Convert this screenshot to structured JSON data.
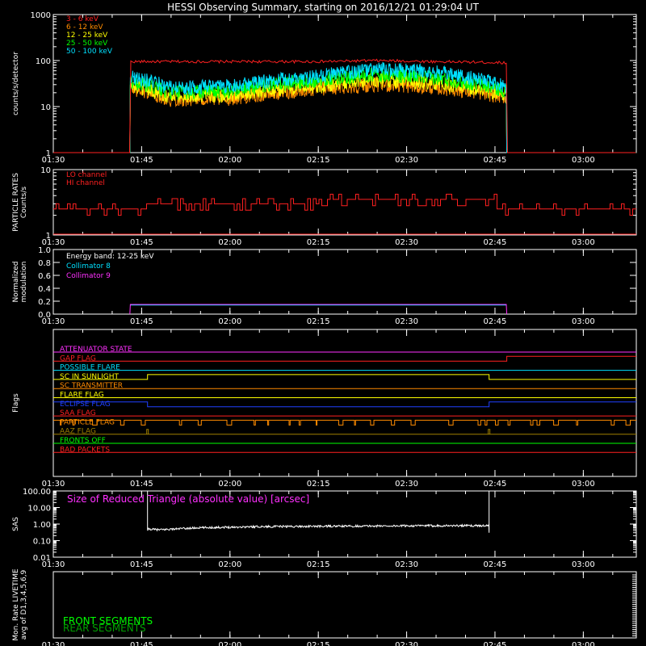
{
  "title": "HESSI Observing Summary, starting on 2016/12/21 01:29:04 UT",
  "time_ticks": [
    "01:30",
    "01:45",
    "02:00",
    "02:15",
    "02:30",
    "02:45",
    "03:00"
  ],
  "colors": {
    "c3_6": "#ff2020",
    "c6_12": "#ff8c00",
    "c12_25": "#ffff00",
    "c25_50": "#00ff00",
    "c50_100": "#00e0ff",
    "lo": "#ff2020",
    "hi": "#ff2020",
    "collimator8": "#00e0ff",
    "collimator9": "#ff30ff",
    "sas": "#ffffff",
    "front": "#00ff00",
    "rear": "#00a000"
  },
  "chart_data": [
    {
      "id": "count-rates",
      "type": "line",
      "ylabel": "counts/s/detector",
      "yscale": "log",
      "ylim": [
        1,
        1000
      ],
      "yticks": [
        "1",
        "10",
        "100",
        "1000"
      ],
      "xlim": [
        "01:30",
        "03:09"
      ],
      "series": [
        {
          "name": "3 - 6 keV",
          "x": [
            "01:30",
            "01:43",
            "01:43",
            "02:00",
            "02:15",
            "02:25",
            "02:35",
            "02:47",
            "02:47",
            "03:09"
          ],
          "values": [
            1,
            1,
            95,
            95,
            95,
            100,
            95,
            90,
            1,
            1
          ]
        },
        {
          "name": "6 - 12 keV",
          "x": [
            "01:30",
            "01:43",
            "01:43",
            "01:50",
            "02:00",
            "02:15",
            "02:25",
            "02:35",
            "02:47",
            "02:47",
            "03:09"
          ],
          "values": [
            1,
            1,
            25,
            14,
            15,
            24,
            30,
            26,
            16,
            1,
            1
          ]
        },
        {
          "name": "12 - 25 keV",
          "x": [
            "01:30",
            "01:43",
            "01:43",
            "01:50",
            "02:00",
            "02:15",
            "02:25",
            "02:35",
            "02:47",
            "02:47",
            "03:09"
          ],
          "values": [
            1,
            1,
            28,
            16,
            18,
            28,
            38,
            32,
            18,
            1,
            1
          ]
        },
        {
          "name": "25 - 50 keV",
          "x": [
            "01:30",
            "01:43",
            "01:43",
            "01:50",
            "02:00",
            "02:15",
            "02:25",
            "02:35",
            "02:47",
            "02:47",
            "03:09"
          ],
          "values": [
            1,
            1,
            35,
            20,
            22,
            38,
            50,
            42,
            22,
            1,
            1
          ]
        },
        {
          "name": "50 - 100 keV",
          "x": [
            "01:30",
            "01:43",
            "01:43",
            "01:50",
            "02:00",
            "02:15",
            "02:25",
            "02:35",
            "02:47",
            "02:47",
            "03:09"
          ],
          "values": [
            1,
            1,
            45,
            25,
            28,
            45,
            65,
            55,
            28,
            1,
            1
          ]
        }
      ]
    },
    {
      "id": "particle-rates",
      "type": "line",
      "ylabel": "PARTICLE RATES Counts/s",
      "yscale": "log",
      "ylim": [
        1,
        10
      ],
      "yticks": [
        "1",
        "10"
      ],
      "xlim": [
        "01:30",
        "03:09"
      ],
      "series": [
        {
          "name": "LO channel",
          "x": [
            "01:30",
            "01:47",
            "01:47",
            "02:15",
            "02:15",
            "02:45",
            "02:45",
            "03:09"
          ],
          "values": [
            2.5,
            2.5,
            3,
            3,
            3.5,
            3.5,
            2.5,
            2.5
          ]
        },
        {
          "name": "HI channel",
          "x": [
            "01:30",
            "03:09"
          ],
          "values": [
            1,
            1
          ]
        }
      ]
    },
    {
      "id": "modulation",
      "type": "line",
      "ylabel": "Normalized modulation",
      "ylim": [
        0,
        1
      ],
      "yticks": [
        "0.0",
        "0.2",
        "0.4",
        "0.6",
        "0.8",
        "1.0"
      ],
      "annotation": "Energy band: 12-25 keV",
      "xlim": [
        "01:30",
        "03:09"
      ],
      "series": [
        {
          "name": "Collimator 8",
          "x": [
            "01:43",
            "02:47"
          ],
          "values": [
            0.14,
            0.14
          ]
        },
        {
          "name": "Collimator 9",
          "x": [
            "01:43",
            "02:47"
          ],
          "values": [
            0.15,
            0.15
          ]
        }
      ]
    },
    {
      "id": "flags",
      "type": "line",
      "ylabel": "Flags",
      "xlim": [
        "01:30",
        "03:09"
      ],
      "flags": [
        {
          "name": "ATTENUATOR STATE",
          "color": "#ff30ff",
          "x": [
            "01:30",
            "03:09"
          ],
          "values": [
            0,
            0
          ]
        },
        {
          "name": "GAP FLAG",
          "color": "#ff2020",
          "x": [
            "01:30",
            "02:47",
            "02:47",
            "03:09"
          ],
          "values": [
            0,
            0,
            1,
            1
          ]
        },
        {
          "name": "POSSIBLE FLARE",
          "color": "#00e0ff",
          "x": [
            "01:30",
            "03:09"
          ],
          "values": [
            0,
            0
          ]
        },
        {
          "name": "SC IN SUNLIGHT",
          "color": "#ffff00",
          "x": [
            "01:30",
            "01:46",
            "01:46",
            "02:44",
            "02:44",
            "03:09"
          ],
          "values": [
            0,
            0,
            1,
            1,
            0,
            0
          ]
        },
        {
          "name": "SC TRANSMITTER",
          "color": "#ff8c00",
          "x": [
            "01:30",
            "03:09"
          ],
          "values": [
            0,
            0
          ]
        },
        {
          "name": "FLARE FLAG",
          "color": "#ffff00",
          "x": [
            "01:30",
            "03:09"
          ],
          "values": [
            0,
            0
          ]
        },
        {
          "name": "ECLIPSE FLAG",
          "color": "#2040ff",
          "x": [
            "01:30",
            "01:46",
            "01:46",
            "02:44",
            "02:44",
            "03:09"
          ],
          "values": [
            1,
            1,
            0,
            0,
            1,
            1
          ]
        },
        {
          "name": "SAA FLAG",
          "color": "#ff2020",
          "x": [
            "01:30",
            "03:09"
          ],
          "values": [
            0,
            0
          ]
        },
        {
          "name": "PARTICLE FLAG",
          "color": "#ff8c00",
          "x": [
            "01:30",
            "03:09"
          ],
          "values": [
            1,
            1
          ]
        },
        {
          "name": "AAZ FLAG",
          "color": "#a08000",
          "x": [
            "01:30",
            "03:09"
          ],
          "values": [
            0,
            0
          ]
        },
        {
          "name": "FRONTS OFF",
          "color": "#00ff00",
          "x": [
            "01:30",
            "03:09"
          ],
          "values": [
            0,
            0
          ]
        },
        {
          "name": "BAD PACKETS",
          "color": "#ff2020",
          "x": [
            "01:30",
            "03:09"
          ],
          "values": [
            0,
            0
          ]
        }
      ]
    },
    {
      "id": "sas",
      "type": "line",
      "ylabel": "SAS",
      "yscale": "log",
      "ylim": [
        0.01,
        100
      ],
      "yticks": [
        "0.01",
        "0.10",
        "1.00",
        "10.00",
        "100.00"
      ],
      "annotation": "Size of Reduced Triangle (absolute value) [arcsec]",
      "xlim": [
        "01:30",
        "03:09"
      ],
      "series": [
        {
          "name": "Size of Reduced Triangle",
          "x": [
            "01:46",
            "01:46",
            "01:48",
            "01:55",
            "02:05",
            "02:20",
            "02:35",
            "02:44",
            "02:44"
          ],
          "values": [
            100,
            0.5,
            0.45,
            0.6,
            0.7,
            0.75,
            0.8,
            0.8,
            100
          ]
        }
      ]
    },
    {
      "id": "monitor-rates",
      "type": "line",
      "ylabel": "Mon. Rate LIVETIME avg of D1,3,4,5,6,9",
      "xlim": [
        "01:30",
        "03:09"
      ],
      "series": [
        {
          "name": "FRONT SEGMENTS",
          "x": [],
          "values": []
        },
        {
          "name": "REAR SEGMENTS",
          "x": [],
          "values": []
        }
      ]
    }
  ]
}
